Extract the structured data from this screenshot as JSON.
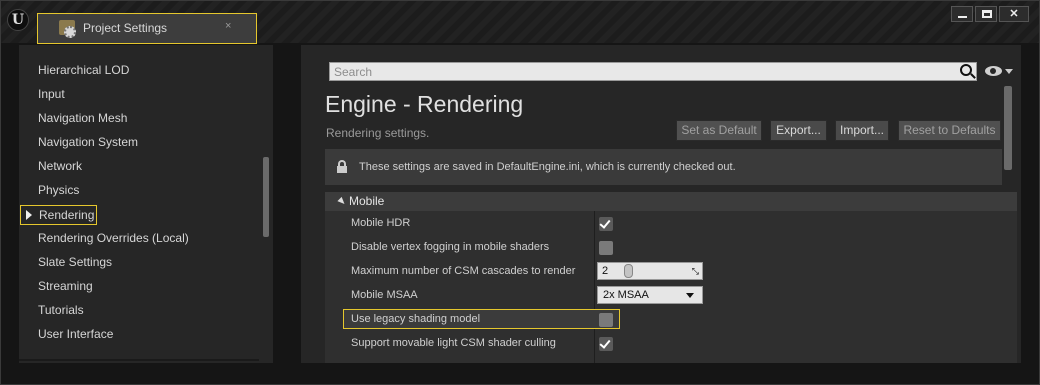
{
  "window": {
    "tab_title": "Project Settings",
    "tab_close": "×",
    "logo_glyph": "U",
    "close_glyph": "✕"
  },
  "sidebar": {
    "items": [
      {
        "label": "Hierarchical LOD"
      },
      {
        "label": "Input"
      },
      {
        "label": "Navigation Mesh"
      },
      {
        "label": "Navigation System"
      },
      {
        "label": "Network"
      },
      {
        "label": "Physics"
      },
      {
        "label": "Rendering",
        "active": true
      },
      {
        "label": "Rendering Overrides (Local)"
      },
      {
        "label": "Slate Settings"
      },
      {
        "label": "Streaming"
      },
      {
        "label": "Tutorials"
      },
      {
        "label": "User Interface"
      }
    ]
  },
  "search": {
    "placeholder": "Search"
  },
  "page": {
    "title": "Engine - Rendering",
    "subtitle": "Rendering settings.",
    "buttons": {
      "set_default": "Set as Default",
      "export": "Export...",
      "import": "Import...",
      "reset": "Reset to Defaults"
    },
    "info": "These settings are saved in DefaultEngine.ini, which is currently checked out."
  },
  "section": {
    "label": "Mobile",
    "rows": [
      {
        "name": "Mobile HDR",
        "checked": true
      },
      {
        "name": "Disable vertex fogging in mobile shaders",
        "checked": false
      },
      {
        "name": "Maximum number of CSM cascades to render",
        "value": "2"
      },
      {
        "name": "Mobile MSAA",
        "value": "2x MSAA"
      },
      {
        "name": "Use legacy shading model",
        "checked": false
      },
      {
        "name": "Support movable light CSM shader culling",
        "checked": true
      }
    ]
  },
  "colors": {
    "accent": "#e5c72d",
    "background": "#262626"
  }
}
